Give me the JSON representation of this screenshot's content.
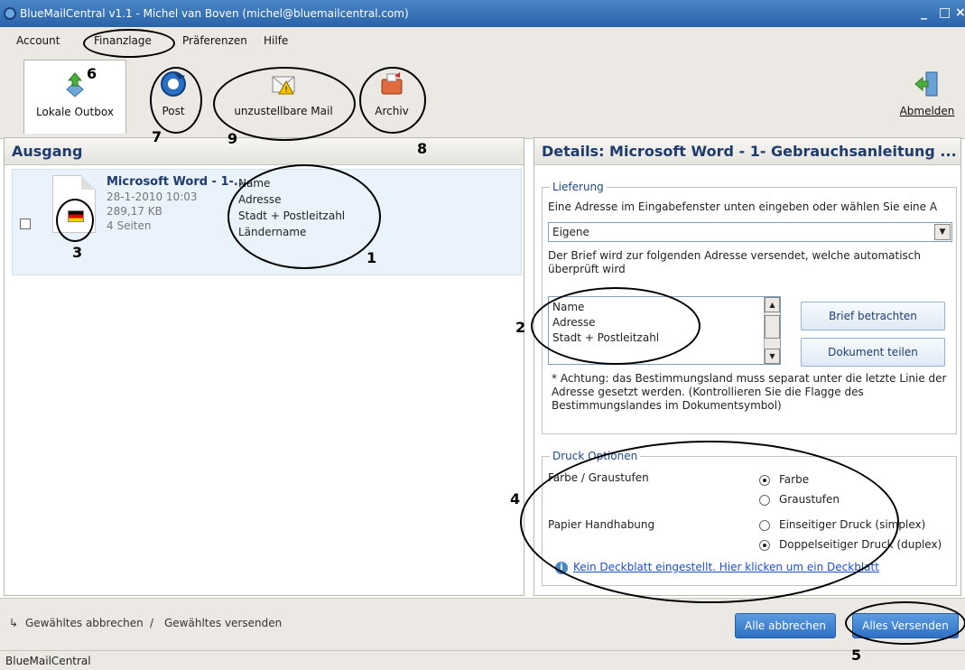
{
  "titlebar": {
    "title": "BlueMailCentral v1.1 - Michel van Boven (michel@bluemailcentral.com)",
    "minimize": "_",
    "maximize": "□",
    "close": "×"
  },
  "menu": {
    "account": "Account",
    "finance": "Finanzlage",
    "preferences": "Präferenzen",
    "help": "Hilfe"
  },
  "toolbar": {
    "local_outbox": "Lokale Outbox",
    "post": "Post",
    "undeliverable": "unzustellbare Mail",
    "archive": "Archiv",
    "logout": "Abmelden"
  },
  "outbox": {
    "title": "Ausgang",
    "item": {
      "name": "Microsoft Word - 1-...",
      "date": "28-1-2010 10:03",
      "size": "289,17 KB",
      "pages": "4 Seiten",
      "address_lines": [
        "Name",
        "Adresse",
        "Stadt + Postleitzahl",
        "Ländername"
      ]
    }
  },
  "details": {
    "title": "Details: Microsoft Word - 1- Gebrauchsanleitung ...",
    "delivery": {
      "legend": "Lieferung",
      "instruction": "Eine Adresse im Eingabefenster unten eingeben oder wählen Sie eine A",
      "select_value": "Eigene",
      "info": "Der Brief wird zur folgenden Adresse versendet, welche automatisch überprüft wird",
      "address_lines": [
        "Name",
        "Adresse",
        "Stadt + Postleitzahl"
      ],
      "view_letter": "Brief betrachten",
      "share_document": "Dokument teilen",
      "note": "* Achtung: das Bestimmungsland muss separat unter die letzte Linie der Adresse gesetzt werden. (Kontrollieren Sie die Flagge des Bestimmungslandes im Dokumentsymbol)"
    },
    "print": {
      "legend": "Druck Optionen",
      "color_label": "Farbe / Graustufen",
      "color_options": [
        "Farbe",
        "Graustufen"
      ],
      "color_selected": "Farbe",
      "paper_label": "Papier Handhabung",
      "paper_options": [
        "Einseitiger Druck (simplex)",
        "Doppelseitiger Druck (duplex)"
      ],
      "paper_selected": "Doppelseitiger Druck (duplex)",
      "cover_link": "Kein Deckblatt eingestellt. Hier klicken um ein Deckblatt"
    }
  },
  "bottom": {
    "left_action": "Gewähltes abbrechen",
    "separator": "/",
    "right_action": "Gewähltes versenden",
    "cancel_all": "Alle abbrechen",
    "send_all": "Alles Versenden"
  },
  "statusbar": {
    "text": "BlueMailCentral"
  },
  "annotations": [
    "1",
    "2",
    "3",
    "4",
    "5",
    "6",
    "7",
    "8",
    "9"
  ]
}
